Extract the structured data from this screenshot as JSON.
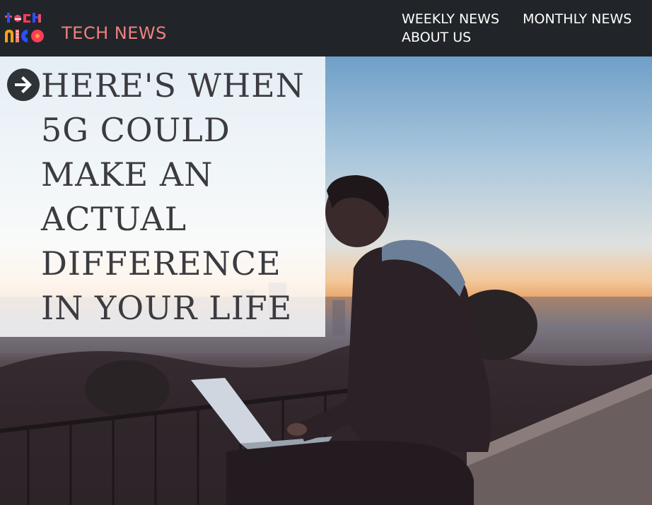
{
  "brand": {
    "name": "TECH NEWS",
    "logo_icon": "technico-logo-icon",
    "accent_color": "#f08080"
  },
  "nav": {
    "items": [
      {
        "label": "WEEKLY NEWS"
      },
      {
        "label": "MONTHLY NEWS"
      },
      {
        "label": "ABOUT US"
      }
    ]
  },
  "hero": {
    "headline": "HERE'S WHEN 5G COULD MAKE AN ACTUAL DIFFERENCE IN YOUR LIFE",
    "arrow_icon": "arrow-right-circle-icon",
    "image_subject": "person-with-laptop-at-sunset-photo"
  },
  "colors": {
    "navbar_bg": "#212529",
    "nav_text": "#ffffff",
    "headline_text": "#3b3b40"
  }
}
